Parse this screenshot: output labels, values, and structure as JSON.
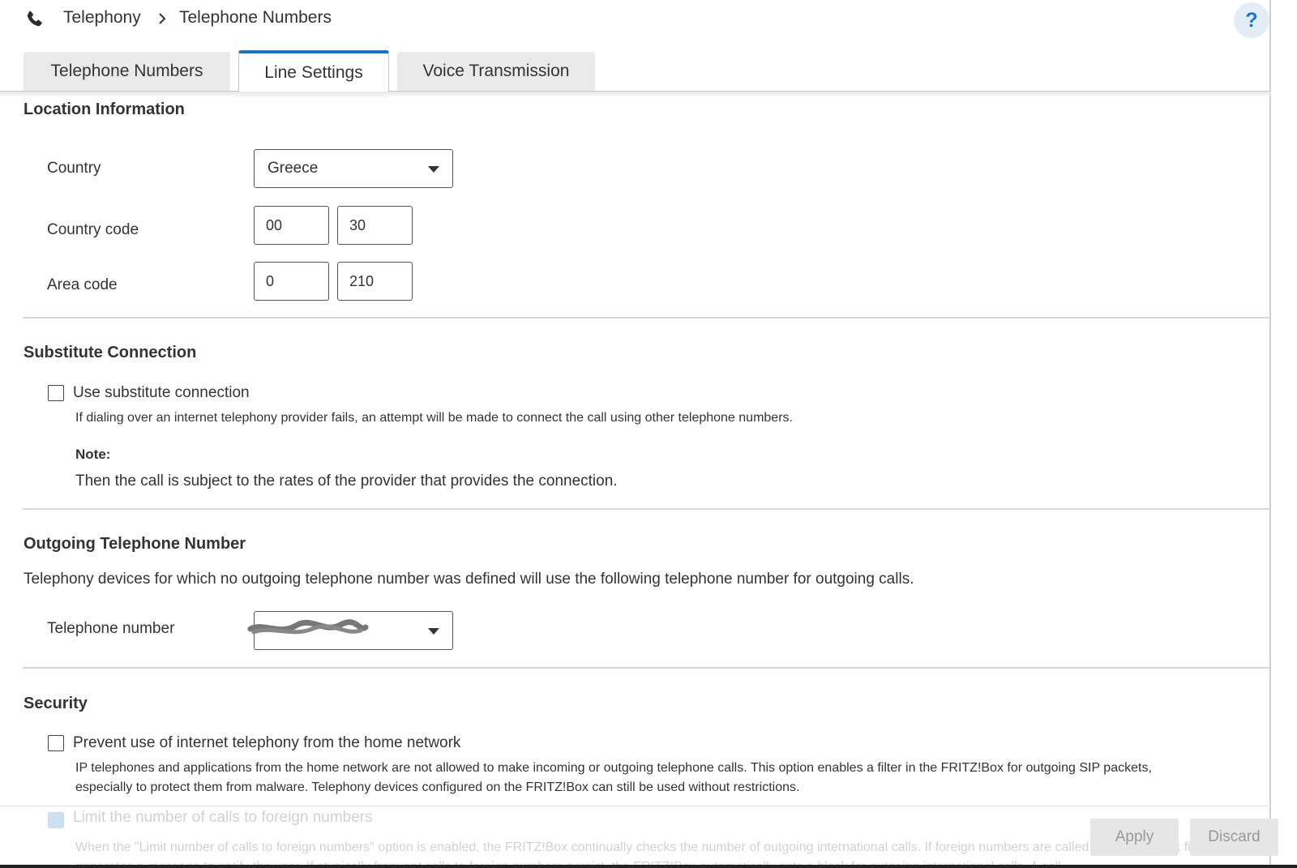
{
  "breadcrumb": {
    "items": [
      "Telephony",
      "Telephone Numbers"
    ]
  },
  "header": {
    "help_label": "?"
  },
  "tabs": [
    {
      "label": "Telephone Numbers",
      "active": false
    },
    {
      "label": "Line Settings",
      "active": true
    },
    {
      "label": "Voice Transmission",
      "active": false
    }
  ],
  "location": {
    "title": "Location Information",
    "country_label": "Country",
    "country_value": "Greece",
    "country_code_label": "Country code",
    "country_code_prefix": "00",
    "country_code_value": "30",
    "area_code_label": "Area code",
    "area_code_prefix": "0",
    "area_code_value": "210"
  },
  "substitute": {
    "title": "Substitute Connection",
    "checkbox_label": "Use substitute connection",
    "checked": false,
    "description": "If dialing over an internet telephony provider fails, an attempt will be made to connect the call using other telephone numbers.",
    "note_title": "Note:",
    "note_text": "Then the call is subject to the rates of the provider that provides the connection."
  },
  "outgoing": {
    "title": "Outgoing Telephone Number",
    "intro": "Telephony devices for which no outgoing telephone number was defined will use the following telephone number for outgoing calls.",
    "number_label": "Telephone number"
  },
  "security": {
    "title": "Security",
    "prevent_label": "Prevent use of internet telephony from the home network",
    "prevent_checked": false,
    "prevent_desc_1": "IP telephones and applications from the home network are not allowed to make incoming or outgoing telephone calls. This option enables a filter in the FRITZ!Box for outgoing SIP packets,",
    "prevent_desc_2": "especially to protect them from malware. Telephony devices configured on the FRITZ!Box can still be used without restrictions.",
    "limit_label": "Limit the number of calls to foreign numbers",
    "limit_checked": true,
    "limit_desc": "When the \"Limit number of calls to foreign numbers\" option is enabled, the FRITZ!Box continually checks the number of outgoing international calls. If foreign numbers are called, the FRITZ!Box first generates a message to notify the user. If atypically frequent calls to foreign numbers persist, the FRITZ!Box automatically sets a block for outgoing international calls. A call"
  },
  "footer": {
    "apply_label": "Apply",
    "discard_label": "Discard"
  },
  "colors": {
    "accent": "#1a73c8",
    "text": "#333333",
    "tab_inactive": "#eaeaea"
  }
}
